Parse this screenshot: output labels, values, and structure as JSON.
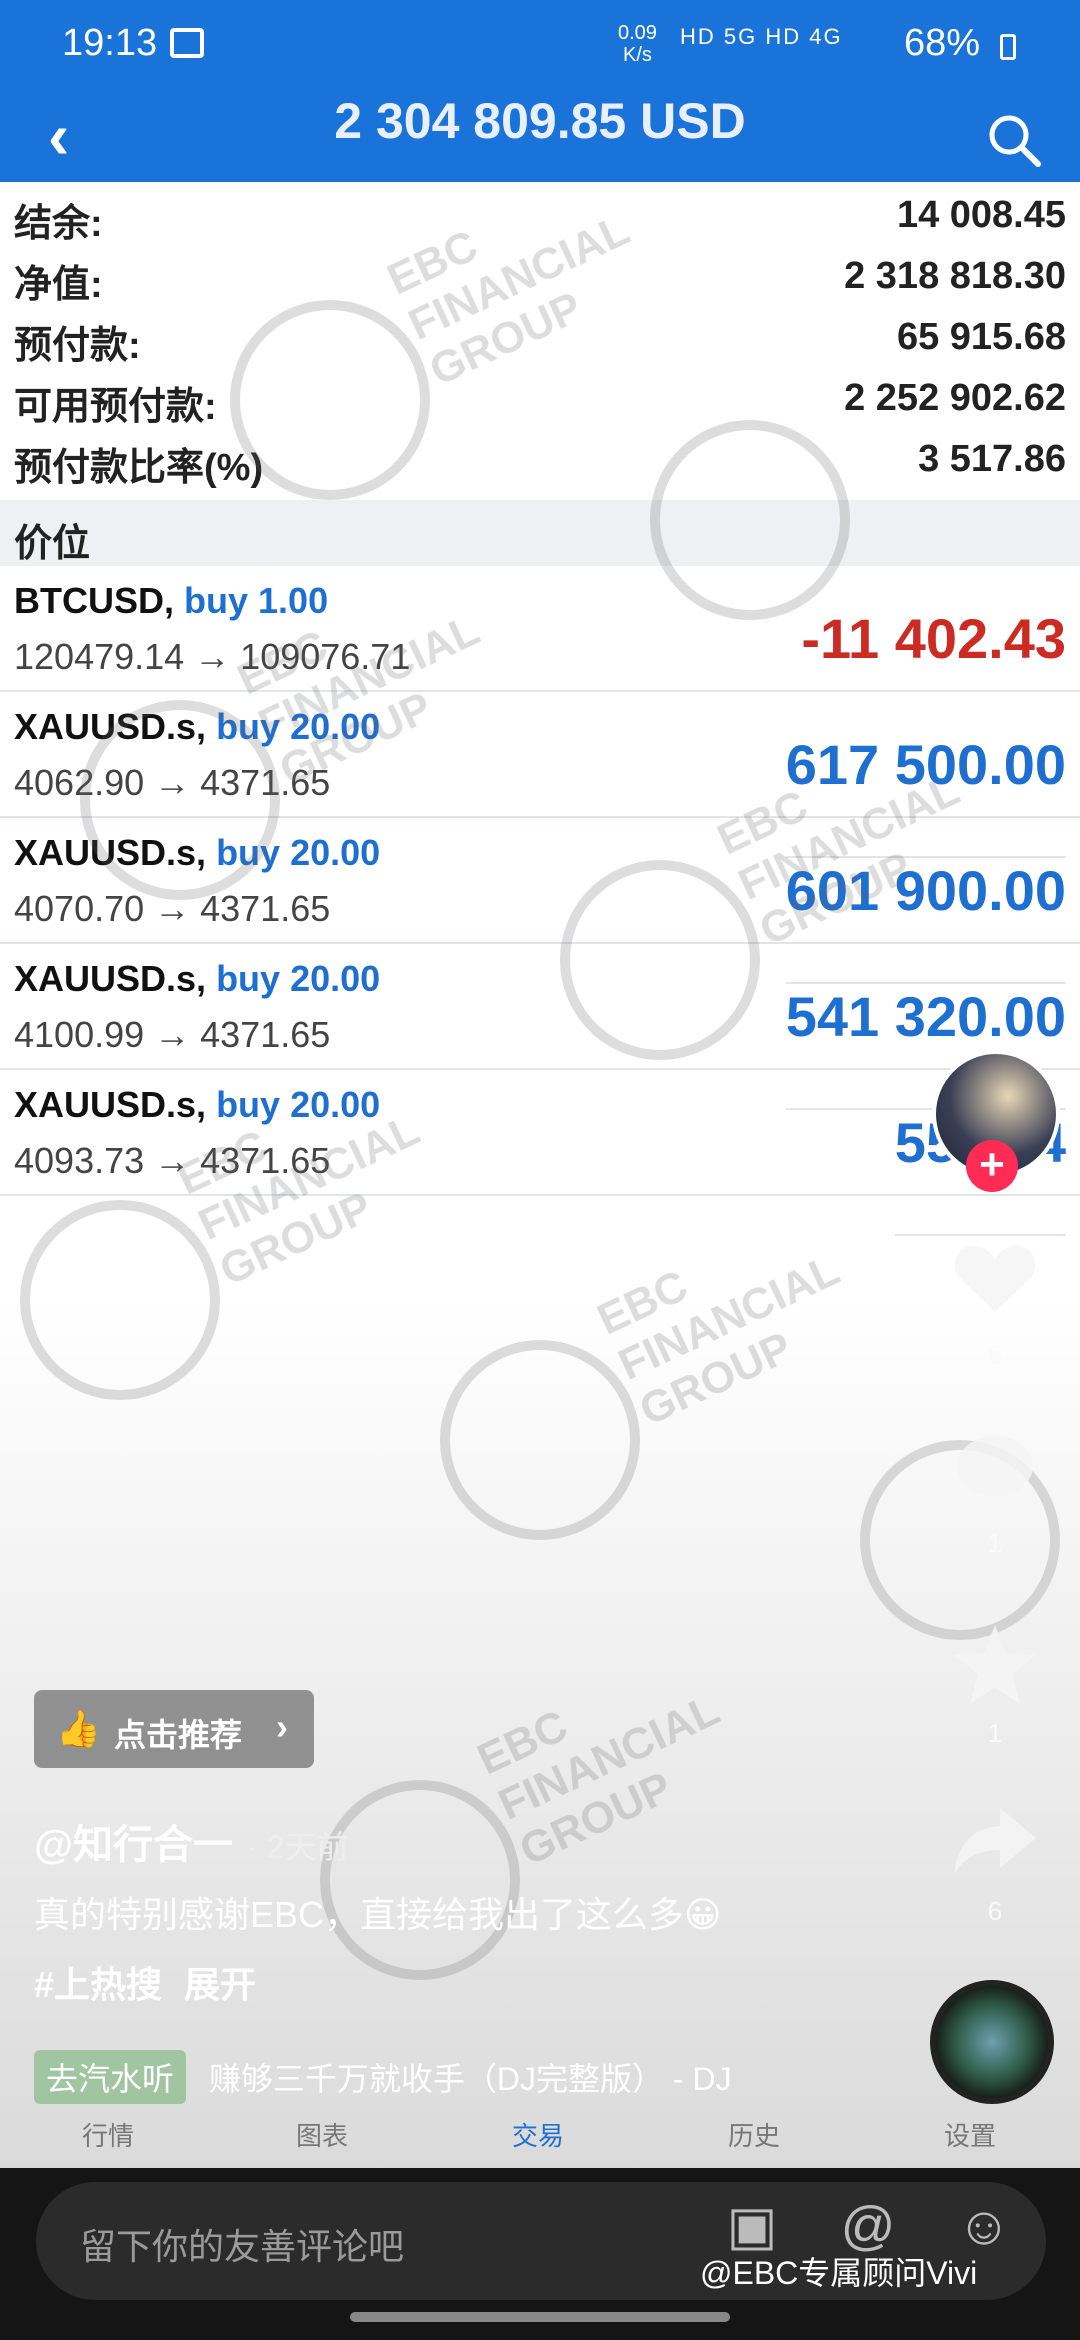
{
  "status_bar": {
    "time": "19:13",
    "net_speed_value": "0.09",
    "net_speed_unit": "K/s",
    "network_labels": "HD 5G HD 4G",
    "battery": "68%"
  },
  "header": {
    "title": "2 304 809.85 USD"
  },
  "account": [
    {
      "label": "结余:",
      "value": "14 008.45"
    },
    {
      "label": "净值:",
      "value": "2 318 818.30"
    },
    {
      "label": "预付款:",
      "value": "65 915.68"
    },
    {
      "label": "可用预付款:",
      "value": "2 252 902.62"
    },
    {
      "label": "预付款比率(%)",
      "value": "3 517.86"
    }
  ],
  "section_title": "价位",
  "positions": [
    {
      "symbol": "BTCUSD,",
      "side": "buy 1.00",
      "prices": "120479.14 → 109076.71",
      "profit": "-11 402.43"
    },
    {
      "symbol": "XAUUSD.s,",
      "side": "buy 20.00",
      "prices": "4062.90 → 4371.65",
      "profit": "617 500.00"
    },
    {
      "symbol": "XAUUSD.s,",
      "side": "buy 20.00",
      "prices": "4070.70 → 4371.65",
      "profit": "601 900.00"
    },
    {
      "symbol": "XAUUSD.s,",
      "side": "buy 20.00",
      "prices": "4100.99 → 4371.65",
      "profit": "541 320.00"
    },
    {
      "symbol": "XAUUSD.s,",
      "side": "buy 20.00",
      "prices": "4093.73 → 4371.65",
      "profit": "555 84"
    }
  ],
  "watermark": {
    "line1": "EBC",
    "line2": "FINANCIAL",
    "line3": "GROUP"
  },
  "video_overlay": {
    "like_count": "6",
    "comment_count": "1",
    "favorite_count": "1",
    "share_count": "6",
    "recommend_label": "点击推荐",
    "author": "@知行合一",
    "post_time": "· 2天前",
    "caption": "真的特别感谢EBC，直接给我出了这么多😀",
    "hashtag": "#上热搜",
    "expand_label": "展开",
    "music_tag": "去汽水听",
    "music_title": "赚够三千万就收手（DJ完整版） - DJ"
  },
  "bottom_tabs": [
    "行情",
    "图表",
    "交易",
    "历史",
    "设置"
  ],
  "comment": {
    "placeholder": "留下你的友善评论吧"
  },
  "credit": "@EBC专属顾问Vivi",
  "colors": {
    "header_blue": "#1a73d9",
    "profit_blue": "#1f6fd1",
    "loss_red": "#cc2b24",
    "follow_red": "#fe2c55"
  }
}
